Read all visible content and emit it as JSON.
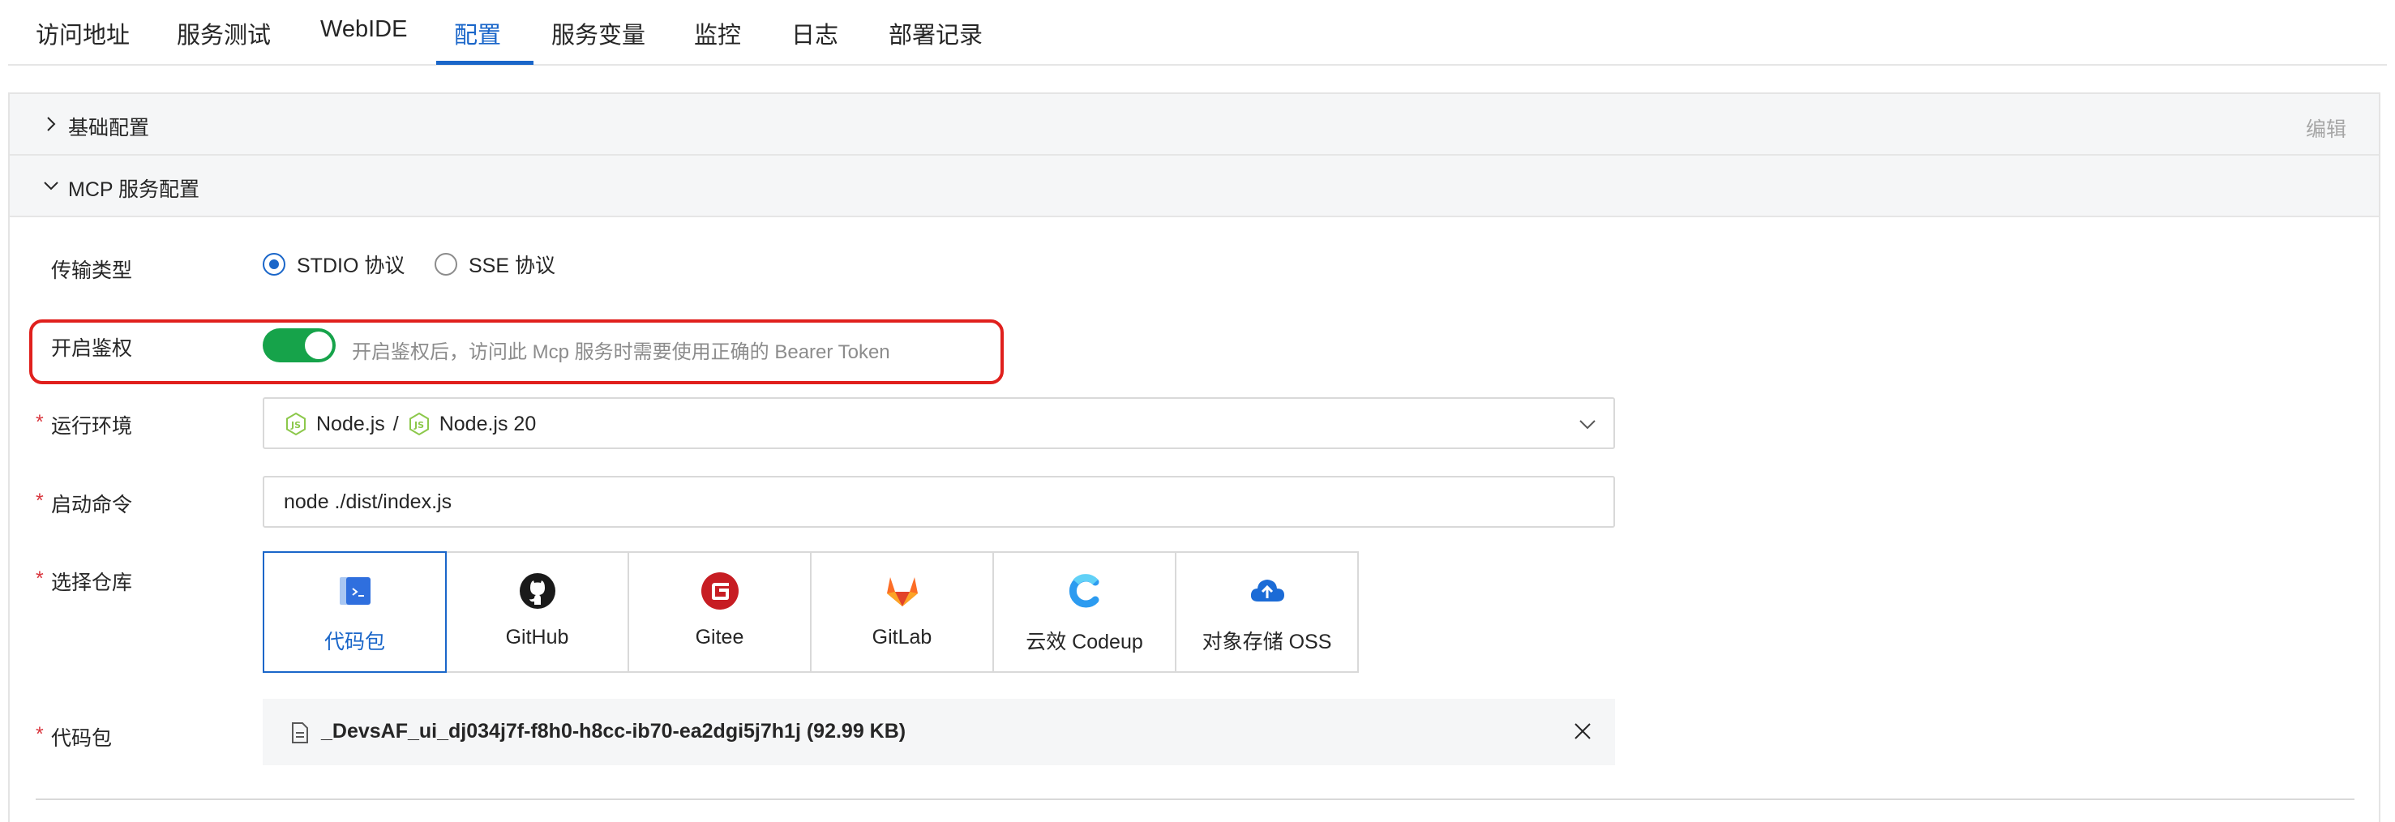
{
  "tabs": [
    {
      "label": "访问地址"
    },
    {
      "label": "服务测试"
    },
    {
      "label": "WebIDE"
    },
    {
      "label": "配置"
    },
    {
      "label": "服务变量"
    },
    {
      "label": "监控"
    },
    {
      "label": "日志"
    },
    {
      "label": "部署记录"
    }
  ],
  "active_tab": "配置",
  "basic_section": {
    "title": "基础配置",
    "edit_label": "编辑",
    "collapsed": true
  },
  "mcp_section": {
    "title": "MCP 服务配置",
    "expanded": true
  },
  "form": {
    "transport": {
      "label": "传输类型",
      "options": [
        "STDIO 协议",
        "SSE 协议"
      ],
      "selected": "STDIO 协议"
    },
    "auth": {
      "label": "开启鉴权",
      "enabled": true,
      "hint": "开启鉴权后，访问此 Mcp 服务时需要使用正确的 Bearer Token"
    },
    "runtime": {
      "label": "运行环境",
      "required_mark": "*",
      "value_part1": "Node.js",
      "separator": "/",
      "value_part2": "Node.js 20"
    },
    "command": {
      "label": "启动命令",
      "required_mark": "*",
      "value": "node ./dist/index.js"
    },
    "repo": {
      "label": "选择仓库",
      "required_mark": "*",
      "options": [
        {
          "name": "代码包",
          "icon": "code-package-icon"
        },
        {
          "name": "GitHub",
          "icon": "github-icon"
        },
        {
          "name": "Gitee",
          "icon": "gitee-icon"
        },
        {
          "name": "GitLab",
          "icon": "gitlab-icon"
        },
        {
          "name": "云效 Codeup",
          "icon": "codeup-icon"
        },
        {
          "name": "对象存储 OSS",
          "icon": "oss-icon"
        }
      ],
      "selected": "代码包"
    },
    "package": {
      "label": "代码包",
      "required_mark": "*",
      "file": "_DevsAF_ui_dj034j7f-f8h0-h8cc-ib70-ea2dgi5j7h1j   (92.99 KB)"
    }
  },
  "colors": {
    "accent": "#1a66c9",
    "toggle_on": "#16a34a",
    "highlight": "#e0201d",
    "required": "#d9363e"
  }
}
